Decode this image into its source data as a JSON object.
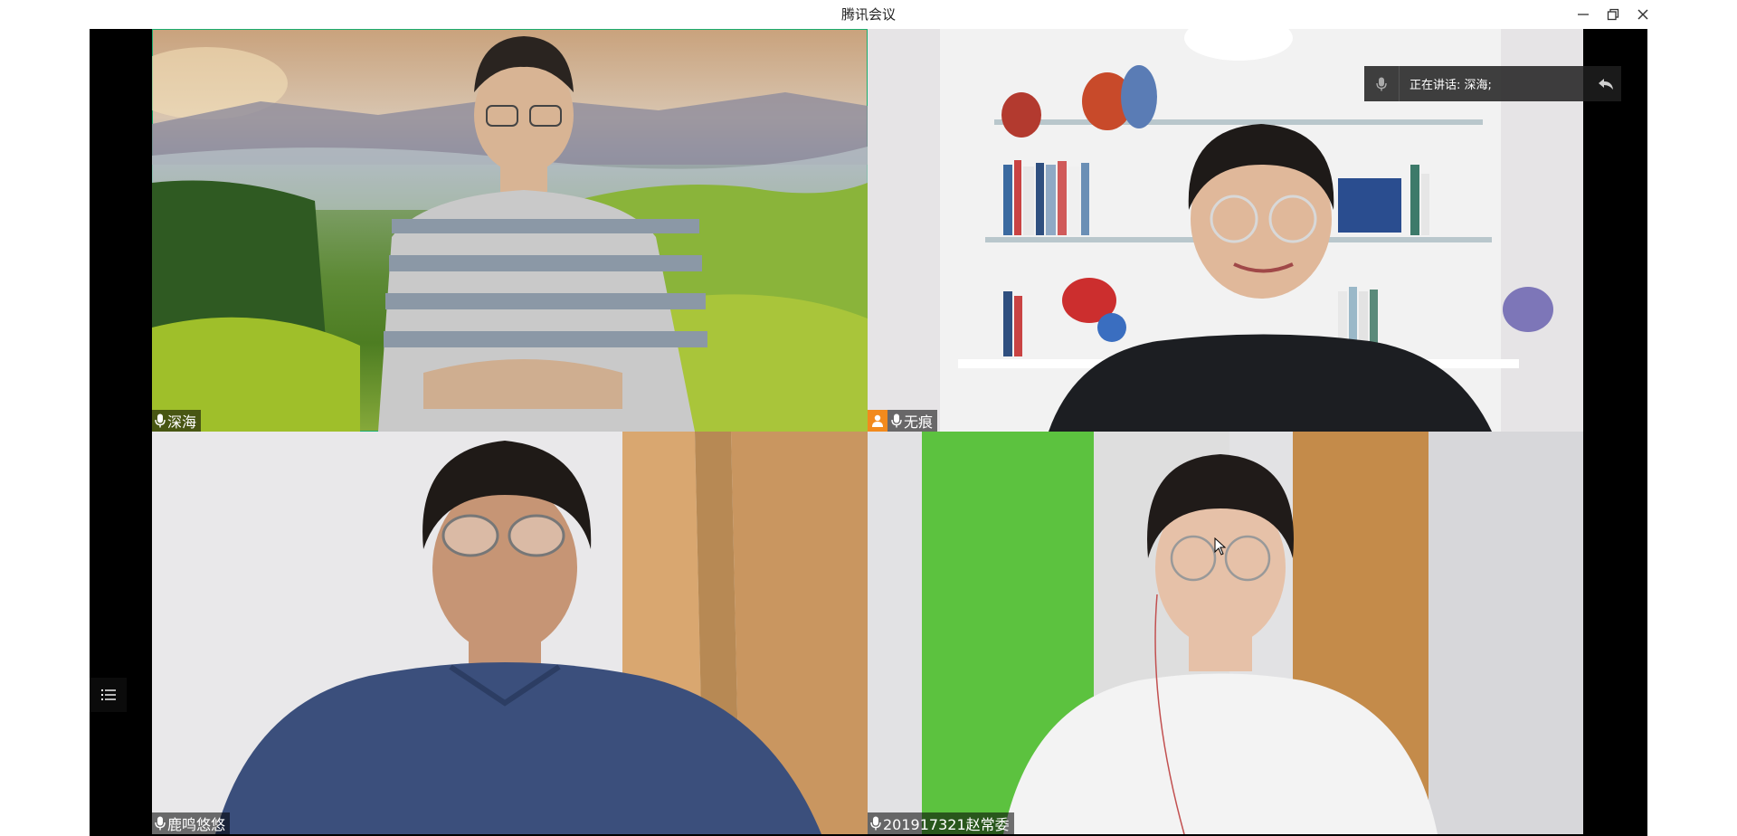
{
  "window": {
    "title": "腾讯会议"
  },
  "participants": [
    {
      "name": "深海",
      "active": true,
      "host": false
    },
    {
      "name": "无痕",
      "active": false,
      "host": true
    },
    {
      "name": "鹿鸣悠悠",
      "active": false,
      "host": false
    },
    {
      "name": "201917321赵常委",
      "active": false,
      "host": false
    }
  ],
  "speaker_indicator": {
    "text": "正在讲话: 深海;"
  },
  "colors": {
    "active_border": "#1aad6e",
    "host_badge": "#f28a1d",
    "window_bg": "#000000"
  },
  "icons": {
    "minimize": "minimize-icon",
    "restore": "restore-icon",
    "close": "close-icon",
    "mic": "microphone-icon",
    "host": "person-icon",
    "list": "list-icon",
    "back": "reply-arrow-icon"
  }
}
